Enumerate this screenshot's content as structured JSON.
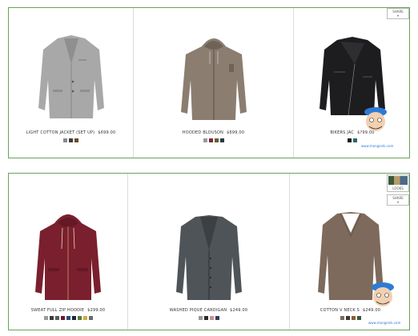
{
  "top_row": [
    {
      "name": "LIGHT COTTON JACKET (SET UP)",
      "price": "$699.00",
      "swatches": [
        "#8a8a8a",
        "#3d3d3d",
        "#6b4a2a"
      ]
    },
    {
      "name": "HOODED BLOUSON",
      "price": "$699.00",
      "swatches": [
        "#9a9a9a",
        "#7a2a3a",
        "#6b5a2a",
        "#2a3a4a"
      ]
    },
    {
      "name": "BIKERS JAC",
      "price": "$?99.00",
      "swatches": [
        "#1a1a1a",
        "#2a6a6a"
      ]
    }
  ],
  "bottom_row": [
    {
      "name": "SWEAT FULL ZIP HOODIE",
      "price": "$299.00",
      "swatches": [
        "#9a9a9a",
        "#3a3a3a",
        "#5a5a5a",
        "#6a1a2a",
        "#2a4a7a",
        "#1a2a3a",
        "#5a7a3a",
        "#c8b040",
        "#6a6a6a"
      ]
    },
    {
      "name": "WASHED PIQUE CARDIGAN",
      "price": "$249.00",
      "swatches": [
        "#9a9a9a",
        "#2a2a2a",
        "#c89090",
        "#3a3a5a"
      ]
    },
    {
      "name": "COTTON V NECK S",
      "price": "$249.00",
      "swatches": [
        "#7a6a5a",
        "#3a3a3a",
        "#8a5a3a",
        "#3a5a3a"
      ]
    }
  ],
  "share_label": "SHARE",
  "looks_label": "LOOKS",
  "watermark": "www.mongenik.com"
}
